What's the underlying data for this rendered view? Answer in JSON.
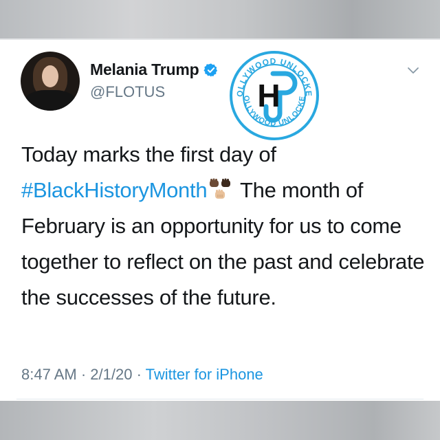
{
  "tweet": {
    "name": "Melania Trump",
    "handle": "@FLOTUS",
    "text_line1": "Today marks the first day of",
    "hashtag": "#BlackHistoryMonth",
    "text_after_hashtag": " The month of",
    "text_rest": "February is an opportunity for us to come together to reflect on the past and celebrate the successes of the future.",
    "time": "8:47 AM",
    "separator": " · ",
    "date": "2/1/20",
    "source": "Twitter for iPhone"
  },
  "watermark": {
    "top_text": "HOLLYWOOD UNLOCKED",
    "bottom_text": "HOLLYWOOD UNLOCKED",
    "letter": "H"
  },
  "colors": {
    "verified": "#1da1f2",
    "link": "#1b95e0",
    "secondary_text": "#657786",
    "logo_blue": "#29a8e0"
  },
  "icons": {
    "verified": "verified-badge-icon",
    "menu": "chevron-down-icon",
    "emoji": "raised-fist-emoji-icon"
  }
}
